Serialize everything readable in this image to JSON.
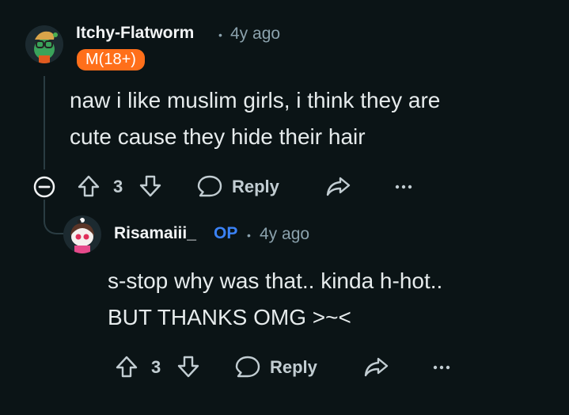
{
  "comments": [
    {
      "username": "Itchy-Flatworm",
      "time": "4y ago",
      "flair": "M(18+)",
      "body": [
        "naw i like muslim girls, i think they are",
        "cute cause they hide their hair"
      ],
      "votes": "3",
      "reply_label": "Reply"
    },
    {
      "username": "Risamaiii_",
      "op_badge": "OP",
      "time": "4y ago",
      "body": [
        "s-stop why was that.. kinda h-hot..",
        "BUT THANKS OMG >~<"
      ],
      "votes": "3",
      "reply_label": "Reply"
    }
  ],
  "icons": {
    "collapse": "minus-circle-icon",
    "upvote": "arrow-up-icon",
    "downvote": "arrow-down-icon",
    "reply": "speech-bubble-icon",
    "share": "share-arrow-icon",
    "more": "ellipsis-icon"
  },
  "colors": {
    "background": "#0b1416",
    "flair": "#ff6f1a",
    "op": "#3b82f6"
  }
}
